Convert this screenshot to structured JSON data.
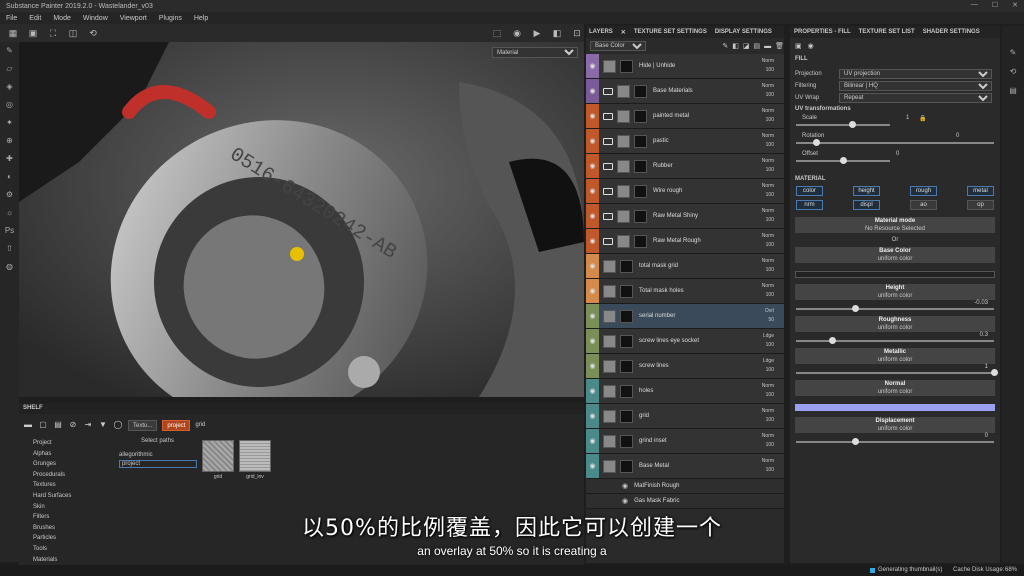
{
  "app": {
    "title": "Substance Painter 2019.2.0 - Wastelander_v03"
  },
  "menu": [
    "File",
    "Edit",
    "Mode",
    "Window",
    "Viewport",
    "Plugins",
    "Help"
  ],
  "viewport": {
    "mode": "Material"
  },
  "shelf": {
    "title": "SHELF",
    "filters": {
      "chip1": "Textu...",
      "chip2": "project",
      "search": "grid"
    },
    "categories": [
      "Project",
      "Alphas",
      "Grunges",
      "Procedurals",
      "Textures",
      "Hard Surfaces",
      "Skin",
      "Filters",
      "Brushes",
      "Particles",
      "Tools",
      "Materials"
    ],
    "select_paths": "Select paths",
    "paths": [
      "allegorithmic",
      "project"
    ],
    "thumbs": [
      "grid",
      "grid_inv"
    ]
  },
  "layers": {
    "tabs": [
      "LAYERS",
      "TEXTURE SET SETTINGS",
      "DISPLAY SETTINGS"
    ],
    "channel": "Base Color",
    "rows": [
      {
        "name": "Hide | Unhide",
        "blend": "Norm",
        "opacity": "100",
        "color": "#8a6aa8",
        "type": "layer"
      },
      {
        "name": "Base Materials",
        "blend": "Norm",
        "opacity": "100",
        "color": "#7a5a98",
        "type": "folder"
      },
      {
        "name": "painted metal",
        "blend": "Norm",
        "opacity": "100",
        "color": "#c0582a",
        "type": "folder"
      },
      {
        "name": "pastic",
        "blend": "Norm",
        "opacity": "100",
        "color": "#c0582a",
        "type": "folder"
      },
      {
        "name": "Rubber",
        "blend": "Norm",
        "opacity": "100",
        "color": "#c0582a",
        "type": "folder"
      },
      {
        "name": "Wire rough",
        "blend": "Norm",
        "opacity": "100",
        "color": "#c0582a",
        "type": "folder"
      },
      {
        "name": "Raw Metal Shiny",
        "blend": "Norm",
        "opacity": "100",
        "color": "#c0582a",
        "type": "folder"
      },
      {
        "name": "Raw Metal Rough",
        "blend": "Norm",
        "opacity": "100",
        "color": "#c0582a",
        "type": "folder"
      },
      {
        "name": "total mask grid",
        "blend": "Norm",
        "opacity": "100",
        "color": "#d38a4a",
        "type": "layer"
      },
      {
        "name": "Total mask holes",
        "blend": "Norm",
        "opacity": "100",
        "color": "#d38a4a",
        "type": "layer"
      },
      {
        "name": "serial number",
        "blend": "Ovrl",
        "opacity": "50",
        "color": "#7a8f58",
        "type": "layer"
      },
      {
        "name": "screw lines eye socket",
        "blend": "Ldge",
        "opacity": "100",
        "color": "#7a8f58",
        "type": "layer"
      },
      {
        "name": "screw  lines",
        "blend": "Ldge",
        "opacity": "100",
        "color": "#7a8f58",
        "type": "layer"
      },
      {
        "name": "holes",
        "blend": "Norm",
        "opacity": "100",
        "color": "#4a8a8a",
        "type": "layer"
      },
      {
        "name": "grid",
        "blend": "Norm",
        "opacity": "100",
        "color": "#4a8a8a",
        "type": "layer"
      },
      {
        "name": "grind inset",
        "blend": "Norm",
        "opacity": "100",
        "color": "#4a8a8a",
        "type": "layer"
      },
      {
        "name": "Base Metal",
        "blend": "Norm",
        "opacity": "100",
        "color": "#4a8a8a",
        "type": "layer"
      }
    ],
    "effects": [
      {
        "name": "MatFinish Rough"
      },
      {
        "name": "Gas Mask Fabric"
      }
    ]
  },
  "properties": {
    "tabs": [
      "PROPERTIES - FILL",
      "TEXTURE SET LIST",
      "SHADER SETTINGS"
    ],
    "fill_label": "FILL",
    "projection": {
      "label": "Projection",
      "value": "UV projection"
    },
    "filtering": {
      "label": "Filtering",
      "value": "Bilinear | HQ"
    },
    "uvwrap": {
      "label": "UV Wrap",
      "value": "Repeat"
    },
    "uv_header": "UV transformations",
    "scale": {
      "label": "Scale",
      "value": "1",
      "value2": "1"
    },
    "rotation": {
      "label": "Rotation",
      "value": "0"
    },
    "offset": {
      "label": "Offset",
      "value": "0",
      "value2": "0"
    },
    "material_header": "MATERIAL",
    "mat_buttons": [
      "color",
      "height",
      "rough",
      "metal",
      "nrm",
      "displ",
      "ao",
      "op"
    ],
    "material_mode": {
      "title": "Material mode",
      "value": "No Resource Selected"
    },
    "or": "Or",
    "channels": [
      {
        "title": "Base Color",
        "sub": "uniform color",
        "value": ""
      },
      {
        "title": "Height",
        "sub": "uniform color",
        "value": "-0.03"
      },
      {
        "title": "Roughness",
        "sub": "uniform color",
        "value": "0.3"
      },
      {
        "title": "Metallic",
        "sub": "uniform color",
        "value": "1"
      },
      {
        "title": "Normal",
        "sub": "uniform color",
        "value": ""
      },
      {
        "title": "Displacement",
        "sub": "uniform color",
        "value": "0"
      }
    ]
  },
  "status": {
    "left": "Generating thumbnail(s)",
    "right": "Cache Disk Usage:",
    "pct": "68%"
  },
  "subtitle": {
    "zh": "以50%的比例覆盖，因此它可以创建一个",
    "en": "an overlay at 50% so it is creating a"
  }
}
